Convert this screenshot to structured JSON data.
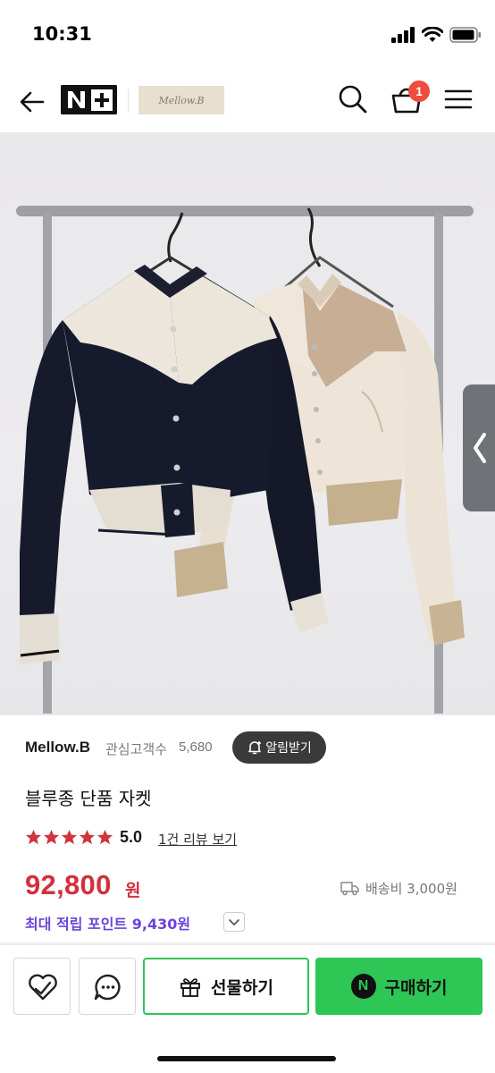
{
  "status_bar": {
    "time": "10:31"
  },
  "header": {
    "back_icon": "arrow-left-icon",
    "np_logo_text": "N+",
    "brand_logo_text": "Mellow.B",
    "cart_badge": "1"
  },
  "product": {
    "store_name": "Mellow.B",
    "followers_label": "관심고객수",
    "followers_count": "5,680",
    "notify_label": "알림받기",
    "title": "블루종 단품 자켓",
    "rating": "5.0",
    "stars": 5,
    "review_link": "1건 리뷰 보기",
    "price": "92,800",
    "price_unit": "원",
    "shipping": "배송비 3,000원",
    "points": "최대 적립 포인트 9,430원"
  },
  "bottom_bar": {
    "gift_label": "선물하기",
    "buy_label": "구매하기",
    "buy_badge": "N"
  },
  "colors": {
    "price": "#d32f3d",
    "points": "#6c43d9",
    "naver_green": "#2ec655",
    "badge": "#ef4b3e"
  }
}
